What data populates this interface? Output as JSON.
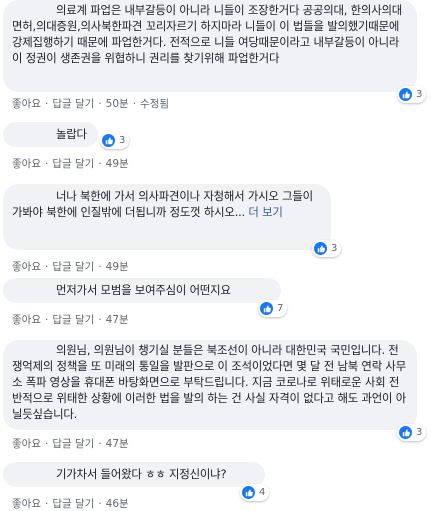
{
  "comments": [
    {
      "text": "의료계 파업은 내부갈등이 아니라 니들이 조장한거다 공공의대, 한의사의대면허,의대증원,의사북한파견 꼬리자르기 하지마라 니들이 이 법들을 발의했기때문에 강제집행하기 때문에 파업한거다. 전적으로 니들 여당때문이라고 내부갈등이 아니라 이 정권이 생존권을 위협하니 권리를 찾기위해 파업한거다",
      "like": "좋아요",
      "reply": "답글 달기",
      "time": "50분",
      "edited": "수정됨",
      "reactions": "3"
    },
    {
      "text": "놀랍다",
      "like": "좋아요",
      "reply": "답글 달기",
      "time": "49분",
      "reactions": "3"
    },
    {
      "text": "너나 북한에 가서 의사파견이나 자청해서 가시오 그들이 가봐야 북한에 인질밖에 더됩니까 정도껏 하시오...",
      "more": "더 보기",
      "like": "좋아요",
      "reply": "답글 달기",
      "time": "49분",
      "reactions": "3"
    },
    {
      "text": "먼저가서 모범을 보여주심이 어떤지요",
      "like": "좋아요",
      "reply": "답글 달기",
      "time": "47분",
      "reactions": "7"
    },
    {
      "text": "의원님, 의원님이 챙기실 분들은 북조선이 아니라 대한민국 국민입니다. 전쟁억제의 정책을 또 미래의 통일을 발판으로 이 조석이었다면 몇 달 전 남북 연락 사무소 폭파 영상을 휴대폰 바탕화면으로 부탁드립니다. 지금 코로나로 위태로운 사회 전반적으로 위태한 상황에 이러한 법을 발의 하는 건 사실 자격이 없다고 해도 과언이 아닐듯싶습니다.",
      "like": "좋아요",
      "reply": "답글 달기",
      "time": "47분",
      "reactions": "3"
    },
    {
      "text": "기가차서 들어왔다 ㅎㅎ 지정신이냐?",
      "like": "좋아요",
      "reply": "답글 달기",
      "time": "46분",
      "reactions": "4"
    }
  ]
}
